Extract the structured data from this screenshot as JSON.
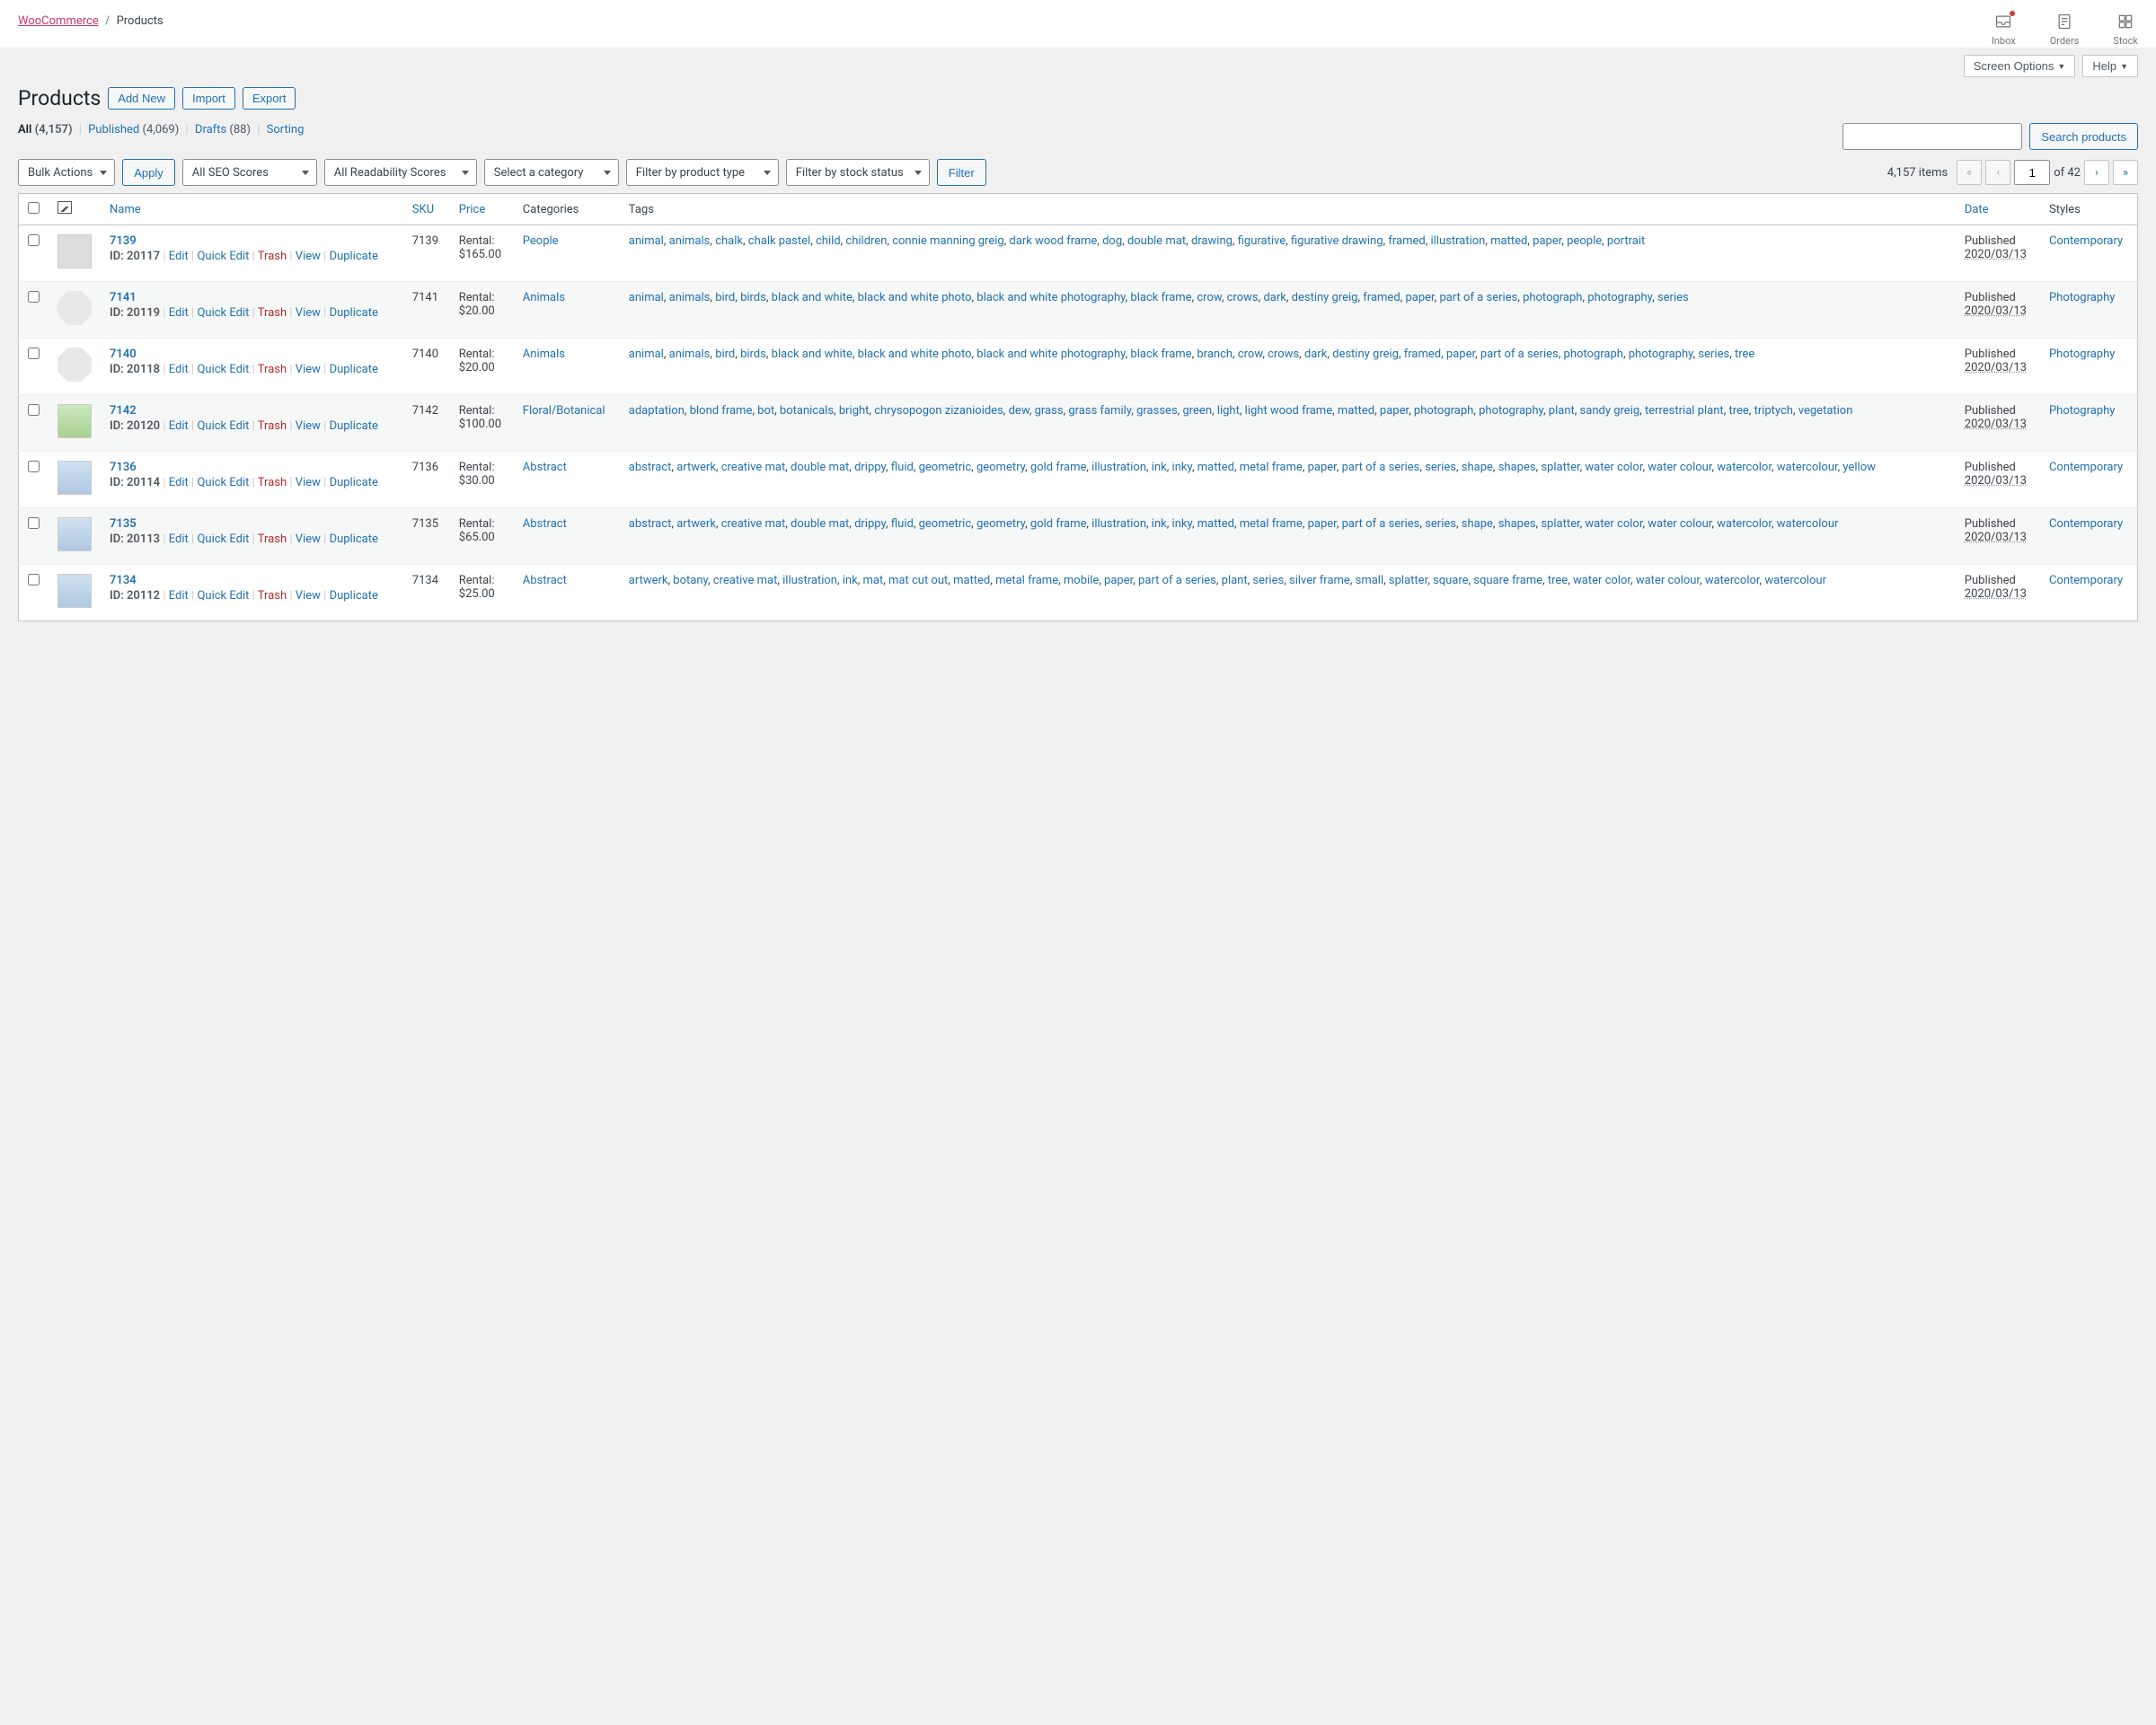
{
  "breadcrumb": {
    "woocommerce": "WooCommerce",
    "products": "Products"
  },
  "top_icons": {
    "inbox": "Inbox",
    "orders": "Orders",
    "stock": "Stock"
  },
  "options": {
    "screen_options": "Screen Options",
    "help": "Help"
  },
  "heading": "Products",
  "actions": {
    "add_new": "Add New",
    "import": "Import",
    "export": "Export"
  },
  "subsubsub": {
    "all_label": "All",
    "all_count": "(4,157)",
    "published_label": "Published",
    "published_count": "(4,069)",
    "drafts_label": "Drafts",
    "drafts_count": "(88)",
    "sorting_label": "Sorting"
  },
  "search": {
    "button": "Search products"
  },
  "filters": {
    "bulk": "Bulk Actions",
    "apply": "Apply",
    "seo": "All SEO Scores",
    "readability": "All Readability Scores",
    "category": "Select a category",
    "product_type": "Filter by product type",
    "stock_status": "Filter by stock status",
    "filter": "Filter"
  },
  "pagination": {
    "items_count": "4,157 items",
    "current": "1",
    "of_text": "of 42"
  },
  "columns": {
    "name": "Name",
    "sku": "SKU",
    "price": "Price",
    "categories": "Categories",
    "tags": "Tags",
    "date": "Date",
    "styles": "Styles"
  },
  "row_actions": {
    "id_prefix": "ID: ",
    "edit": "Edit",
    "quick_edit": "Quick Edit",
    "trash": "Trash",
    "view": "View",
    "duplicate": "Duplicate"
  },
  "rows": [
    {
      "title": "7139",
      "id": "20117",
      "sku": "7139",
      "price_label": "Rental:",
      "price_value": "$165.00",
      "categories": [
        "People"
      ],
      "tags": [
        "animal",
        "animals",
        "chalk",
        "chalk pastel",
        "child",
        "children",
        "connie manning greig",
        "dark wood frame",
        "dog",
        "double mat",
        "drawing",
        "figurative",
        "figurative drawing",
        "framed",
        "illustration",
        "matted",
        "paper",
        "people",
        "portrait"
      ],
      "date_status": "Published",
      "date_value": "2020/03/13",
      "styles": [
        "Contemporary"
      ],
      "thumb_class": "thumb"
    },
    {
      "title": "7141",
      "id": "20119",
      "sku": "7141",
      "price_label": "Rental:",
      "price_value": "$20.00",
      "categories": [
        "Animals"
      ],
      "tags": [
        "animal",
        "animals",
        "bird",
        "birds",
        "black and white",
        "black and white photo",
        "black and white photography",
        "black frame",
        "crow",
        "crows",
        "dark",
        "destiny greig",
        "framed",
        "paper",
        "part of a series",
        "photograph",
        "photography",
        "series"
      ],
      "date_status": "Published",
      "date_value": "2020/03/13",
      "styles": [
        "Photography"
      ],
      "thumb_class": "thumb octagon"
    },
    {
      "title": "7140",
      "id": "20118",
      "sku": "7140",
      "price_label": "Rental:",
      "price_value": "$20.00",
      "categories": [
        "Animals"
      ],
      "tags": [
        "animal",
        "animals",
        "bird",
        "birds",
        "black and white",
        "black and white photo",
        "black and white photography",
        "black frame",
        "branch",
        "crow",
        "crows",
        "dark",
        "destiny greig",
        "framed",
        "paper",
        "part of a series",
        "photograph",
        "photography",
        "series",
        "tree"
      ],
      "date_status": "Published",
      "date_value": "2020/03/13",
      "styles": [
        "Photography"
      ],
      "thumb_class": "thumb octagon"
    },
    {
      "title": "7142",
      "id": "20120",
      "sku": "7142",
      "price_label": "Rental:",
      "price_value": "$100.00",
      "categories": [
        "Floral/Botanical"
      ],
      "tags": [
        "adaptation",
        "blond frame",
        "bot",
        "botanicals",
        "bright",
        "chrysopogon zizanioides",
        "dew",
        "grass",
        "grass family",
        "grasses",
        "green",
        "light",
        "light wood frame",
        "matted",
        "paper",
        "photograph",
        "photography",
        "plant",
        "sandy greig",
        "terrestrial plant",
        "tree",
        "triptych",
        "vegetation"
      ],
      "date_status": "Published",
      "date_value": "2020/03/13",
      "styles": [
        "Photography"
      ],
      "thumb_class": "thumb green"
    },
    {
      "title": "7136",
      "id": "20114",
      "sku": "7136",
      "price_label": "Rental:",
      "price_value": "$30.00",
      "categories": [
        "Abstract"
      ],
      "tags": [
        "abstract",
        "artwerk",
        "creative mat",
        "double mat",
        "drippy",
        "fluid",
        "geometric",
        "geometry",
        "gold frame",
        "illustration",
        "ink",
        "inky",
        "matted",
        "metal frame",
        "paper",
        "part of a series",
        "series",
        "shape",
        "shapes",
        "splatter",
        "water color",
        "water colour",
        "watercolor",
        "watercolour",
        "yellow"
      ],
      "date_status": "Published",
      "date_value": "2020/03/13",
      "styles": [
        "Contemporary"
      ],
      "thumb_class": "thumb blue"
    },
    {
      "title": "7135",
      "id": "20113",
      "sku": "7135",
      "price_label": "Rental:",
      "price_value": "$65.00",
      "categories": [
        "Abstract"
      ],
      "tags": [
        "abstract",
        "artwerk",
        "creative mat",
        "double mat",
        "drippy",
        "fluid",
        "geometric",
        "geometry",
        "gold frame",
        "illustration",
        "ink",
        "inky",
        "matted",
        "metal frame",
        "paper",
        "part of a series",
        "series",
        "shape",
        "shapes",
        "splatter",
        "water color",
        "water colour",
        "watercolor",
        "watercolour"
      ],
      "date_status": "Published",
      "date_value": "2020/03/13",
      "styles": [
        "Contemporary"
      ],
      "thumb_class": "thumb blue"
    },
    {
      "title": "7134",
      "id": "20112",
      "sku": "7134",
      "price_label": "Rental:",
      "price_value": "$25.00",
      "categories": [
        "Abstract"
      ],
      "tags": [
        "artwerk",
        "botany",
        "creative mat",
        "illustration",
        "ink",
        "mat",
        "mat cut out",
        "matted",
        "metal frame",
        "mobile",
        "paper",
        "part of a series",
        "plant",
        "series",
        "silver frame",
        "small",
        "splatter",
        "square",
        "square frame",
        "tree",
        "water color",
        "water colour",
        "watercolor",
        "watercolour"
      ],
      "date_status": "Published",
      "date_value": "2020/03/13",
      "styles": [
        "Contemporary"
      ],
      "thumb_class": "thumb blue"
    }
  ]
}
